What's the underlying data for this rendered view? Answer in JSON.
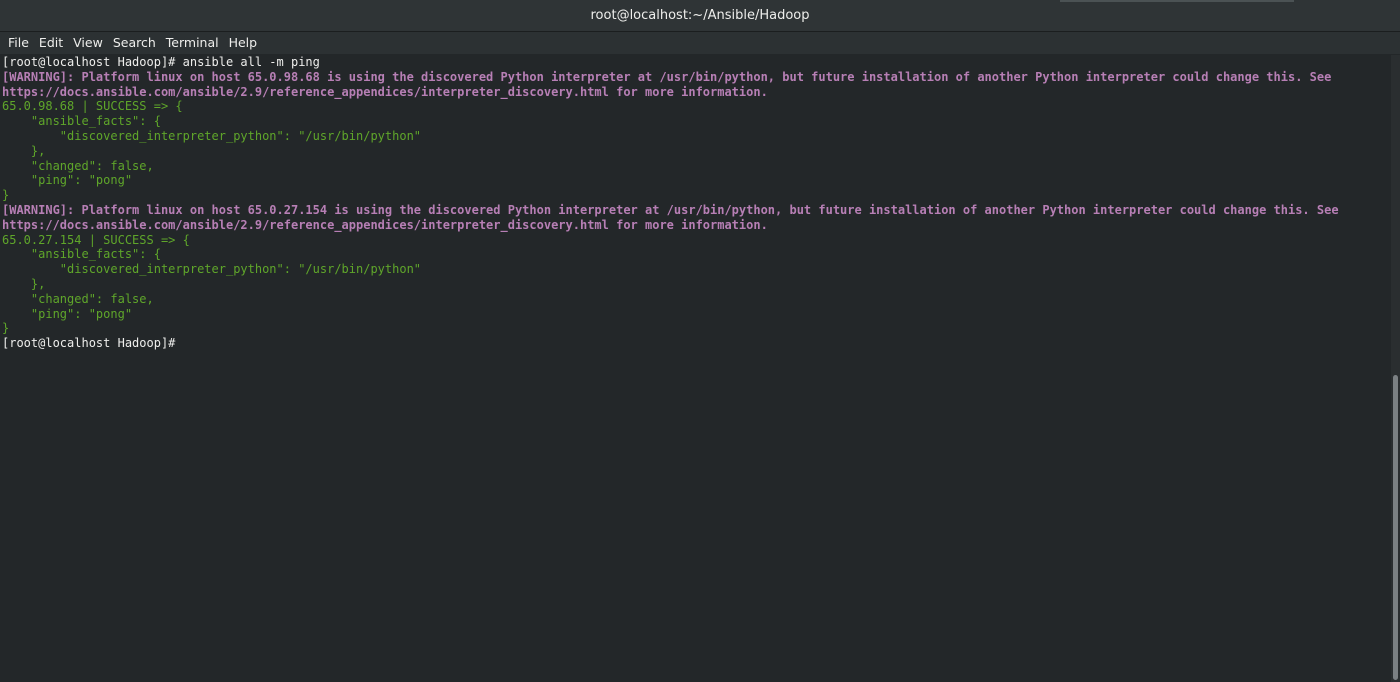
{
  "window": {
    "title": "root@localhost:~/Ansible/Hadoop"
  },
  "menu": {
    "file": "File",
    "edit": "Edit",
    "view": "View",
    "search": "Search",
    "terminal": "Terminal",
    "help": "Help"
  },
  "terminal": {
    "lines": [
      {
        "text": "[root@localhost Hadoop]# ansible all -m ping",
        "style": "white"
      },
      {
        "text": "[WARNING]: Platform linux on host 65.0.98.68 is using the discovered Python interpreter at /usr/bin/python, but future installation of another Python interpreter could change this. See",
        "style": "warn"
      },
      {
        "text": "https://docs.ansible.com/ansible/2.9/reference_appendices/interpreter_discovery.html for more information.",
        "style": "warn"
      },
      {
        "text": "65.0.98.68 | SUCCESS => {",
        "style": "green"
      },
      {
        "text": "    \"ansible_facts\": {",
        "style": "green"
      },
      {
        "text": "        \"discovered_interpreter_python\": \"/usr/bin/python\"",
        "style": "green"
      },
      {
        "text": "    },",
        "style": "green"
      },
      {
        "text": "    \"changed\": false,",
        "style": "green"
      },
      {
        "text": "    \"ping\": \"pong\"",
        "style": "green"
      },
      {
        "text": "}",
        "style": "green"
      },
      {
        "text": "[WARNING]: Platform linux on host 65.0.27.154 is using the discovered Python interpreter at /usr/bin/python, but future installation of another Python interpreter could change this. See",
        "style": "warn"
      },
      {
        "text": "https://docs.ansible.com/ansible/2.9/reference_appendices/interpreter_discovery.html for more information.",
        "style": "warn"
      },
      {
        "text": "65.0.27.154 | SUCCESS => {",
        "style": "green"
      },
      {
        "text": "    \"ansible_facts\": {",
        "style": "green"
      },
      {
        "text": "        \"discovered_interpreter_python\": \"/usr/bin/python\"",
        "style": "green"
      },
      {
        "text": "    },",
        "style": "green"
      },
      {
        "text": "    \"changed\": false,",
        "style": "green"
      },
      {
        "text": "    \"ping\": \"pong\"",
        "style": "green"
      },
      {
        "text": "}",
        "style": "green"
      },
      {
        "text": "[root@localhost Hadoop]# ",
        "style": "white"
      }
    ]
  },
  "colors": {
    "background": "#232729",
    "prompt": "#eeeeec",
    "warning": "#b77fb5",
    "success": "#5fa62a"
  }
}
